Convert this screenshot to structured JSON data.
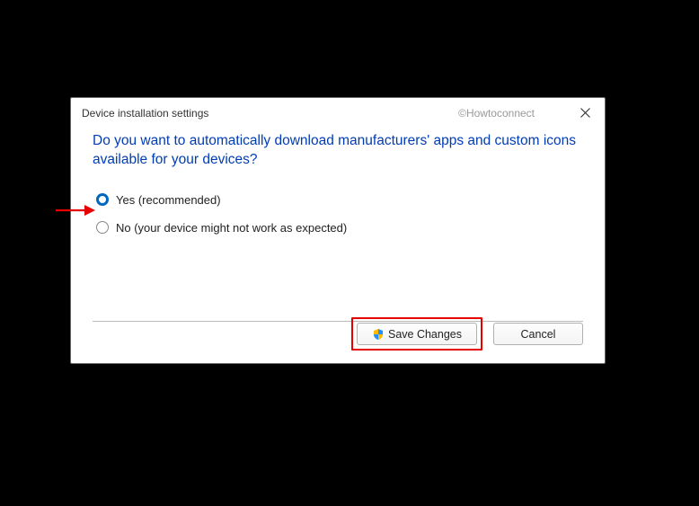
{
  "window": {
    "title": "Device installation settings",
    "watermark": "©Howtoconnect"
  },
  "question": "Do you want to automatically download manufacturers' apps and custom icons available for your devices?",
  "options": {
    "yes": "Yes (recommended)",
    "no": "No (your device might not work as expected)"
  },
  "buttons": {
    "save": "Save Changes",
    "cancel": "Cancel"
  }
}
